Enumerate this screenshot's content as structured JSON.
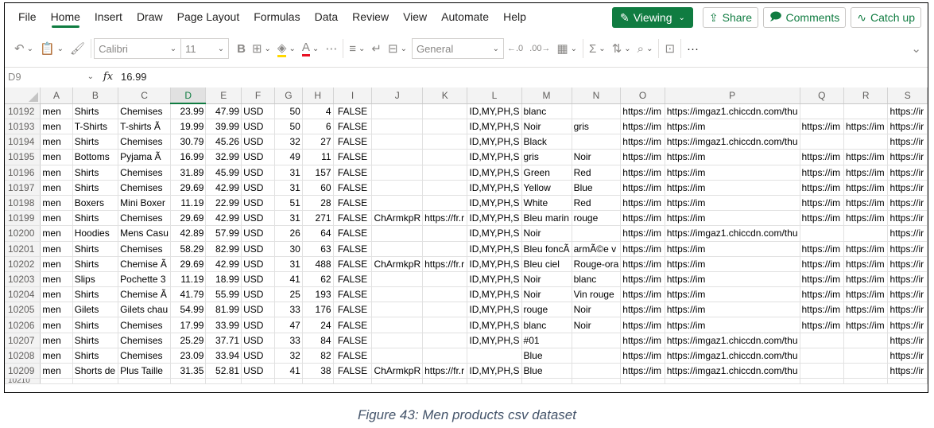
{
  "menu": {
    "items": [
      "File",
      "Home",
      "Insert",
      "Draw",
      "Page Layout",
      "Formulas",
      "Data",
      "Review",
      "View",
      "Automate",
      "Help"
    ],
    "active": "Home",
    "viewing_label": "Viewing",
    "share_label": "Share",
    "comments_label": "Comments",
    "catchup_label": "Catch up"
  },
  "toolbar": {
    "font_name": "Calibri",
    "font_size": "11",
    "number_format": "General",
    "more": "···"
  },
  "formula_bar": {
    "cell_ref": "D9",
    "fx": "fx",
    "value": "16.99"
  },
  "columns": [
    "A",
    "B",
    "C",
    "D",
    "E",
    "F",
    "G",
    "H",
    "I",
    "J",
    "K",
    "L",
    "M",
    "N",
    "O",
    "P",
    "Q",
    "R",
    "S"
  ],
  "selected_column": "D",
  "rows": [
    {
      "n": "10192",
      "A": "men",
      "B": "Shirts",
      "C": "Chemises",
      "D": "23.99",
      "E": "47.99",
      "F": "USD",
      "G": "50",
      "H": "4",
      "I": "FALSE",
      "J": "",
      "K": "",
      "L": "ID,MY,PH,S",
      "M": "blanc",
      "N": "",
      "O": "https://im",
      "P": "https://imgaz1.chiccdn.com/thu",
      "Q": "",
      "R": "",
      "S": "https://ir"
    },
    {
      "n": "10193",
      "A": "men",
      "B": "T-Shirts",
      "C": "T-shirts Ã",
      "D": "19.99",
      "E": "39.99",
      "F": "USD",
      "G": "50",
      "H": "6",
      "I": "FALSE",
      "J": "",
      "K": "",
      "L": "ID,MY,PH,S",
      "M": "Noir",
      "N": "gris",
      "O": "https://im",
      "P": "https://im",
      "Q": "https://im",
      "R": "https://im",
      "S": "https://ir"
    },
    {
      "n": "10194",
      "A": "men",
      "B": "Shirts",
      "C": "Chemises",
      "D": "30.79",
      "E": "45.26",
      "F": "USD",
      "G": "32",
      "H": "27",
      "I": "FALSE",
      "J": "",
      "K": "",
      "L": "ID,MY,PH,S",
      "M": "Black",
      "N": "",
      "O": "https://im",
      "P": "https://imgaz1.chiccdn.com/thu",
      "Q": "",
      "R": "",
      "S": "https://ir"
    },
    {
      "n": "10195",
      "A": "men",
      "B": "Bottoms",
      "C": "Pyjama Ã",
      "D": "16.99",
      "E": "32.99",
      "F": "USD",
      "G": "49",
      "H": "11",
      "I": "FALSE",
      "J": "",
      "K": "",
      "L": "ID,MY,PH,S",
      "M": "gris",
      "N": "Noir",
      "O": "https://im",
      "P": "https://im",
      "Q": "https://im",
      "R": "https://im",
      "S": "https://ir"
    },
    {
      "n": "10196",
      "A": "men",
      "B": "Shirts",
      "C": "Chemises",
      "D": "31.89",
      "E": "45.99",
      "F": "USD",
      "G": "31",
      "H": "157",
      "I": "FALSE",
      "J": "",
      "K": "",
      "L": "ID,MY,PH,S",
      "M": "Green",
      "N": "Red",
      "O": "https://im",
      "P": "https://im",
      "Q": "https://im",
      "R": "https://im",
      "S": "https://ir"
    },
    {
      "n": "10197",
      "A": "men",
      "B": "Shirts",
      "C": "Chemises",
      "D": "29.69",
      "E": "42.99",
      "F": "USD",
      "G": "31",
      "H": "60",
      "I": "FALSE",
      "J": "",
      "K": "",
      "L": "ID,MY,PH,S",
      "M": "Yellow",
      "N": "Blue",
      "O": "https://im",
      "P": "https://im",
      "Q": "https://im",
      "R": "https://im",
      "S": "https://ir"
    },
    {
      "n": "10198",
      "A": "men",
      "B": "Boxers",
      "C": "Mini Boxer",
      "D": "11.19",
      "E": "22.99",
      "F": "USD",
      "G": "51",
      "H": "28",
      "I": "FALSE",
      "J": "",
      "K": "",
      "L": "ID,MY,PH,S",
      "M": "White",
      "N": "Red",
      "O": "https://im",
      "P": "https://im",
      "Q": "https://im",
      "R": "https://im",
      "S": "https://ir"
    },
    {
      "n": "10199",
      "A": "men",
      "B": "Shirts",
      "C": "Chemises",
      "D": "29.69",
      "E": "42.99",
      "F": "USD",
      "G": "31",
      "H": "271",
      "I": "FALSE",
      "J": "ChArmkpR",
      "K": "https://fr.r",
      "L": "ID,MY,PH,S",
      "M": "Bleu marin",
      "N": "rouge",
      "O": "https://im",
      "P": "https://im",
      "Q": "https://im",
      "R": "https://im",
      "S": "https://ir"
    },
    {
      "n": "10200",
      "A": "men",
      "B": "Hoodies",
      "C": "Mens Casu",
      "D": "42.89",
      "E": "57.99",
      "F": "USD",
      "G": "26",
      "H": "64",
      "I": "FALSE",
      "J": "",
      "K": "",
      "L": "ID,MY,PH,S",
      "M": "Noir",
      "N": "",
      "O": "https://im",
      "P": "https://imgaz1.chiccdn.com/thu",
      "Q": "",
      "R": "",
      "S": "https://ir"
    },
    {
      "n": "10201",
      "A": "men",
      "B": "Shirts",
      "C": "Chemises",
      "D": "58.29",
      "E": "82.99",
      "F": "USD",
      "G": "30",
      "H": "63",
      "I": "FALSE",
      "J": "",
      "K": "",
      "L": "ID,MY,PH,S",
      "M": "Bleu foncÃ",
      "N": "armÃ©e v",
      "O": "https://im",
      "P": "https://im",
      "Q": "https://im",
      "R": "https://im",
      "S": "https://ir"
    },
    {
      "n": "10202",
      "A": "men",
      "B": "Shirts",
      "C": "Chemise Ã",
      "D": "29.69",
      "E": "42.99",
      "F": "USD",
      "G": "31",
      "H": "488",
      "I": "FALSE",
      "J": "ChArmkpR",
      "K": "https://fr.r",
      "L": "ID,MY,PH,S",
      "M": "Bleu ciel",
      "N": "Rouge-ora",
      "O": "https://im",
      "P": "https://im",
      "Q": "https://im",
      "R": "https://im",
      "S": "https://ir"
    },
    {
      "n": "10203",
      "A": "men",
      "B": "Slips",
      "C": "Pochette 3",
      "D": "11.19",
      "E": "18.99",
      "F": "USD",
      "G": "41",
      "H": "62",
      "I": "FALSE",
      "J": "",
      "K": "",
      "L": "ID,MY,PH,S",
      "M": "Noir",
      "N": "blanc",
      "O": "https://im",
      "P": "https://im",
      "Q": "https://im",
      "R": "https://im",
      "S": "https://ir"
    },
    {
      "n": "10204",
      "A": "men",
      "B": "Shirts",
      "C": "Chemise Ã",
      "D": "41.79",
      "E": "55.99",
      "F": "USD",
      "G": "25",
      "H": "193",
      "I": "FALSE",
      "J": "",
      "K": "",
      "L": "ID,MY,PH,S",
      "M": "Noir",
      "N": "Vin rouge",
      "O": "https://im",
      "P": "https://im",
      "Q": "https://im",
      "R": "https://im",
      "S": "https://ir"
    },
    {
      "n": "10205",
      "A": "men",
      "B": "Gilets",
      "C": "Gilets chau",
      "D": "54.99",
      "E": "81.99",
      "F": "USD",
      "G": "33",
      "H": "176",
      "I": "FALSE",
      "J": "",
      "K": "",
      "L": "ID,MY,PH,S",
      "M": "rouge",
      "N": "Noir",
      "O": "https://im",
      "P": "https://im",
      "Q": "https://im",
      "R": "https://im",
      "S": "https://ir"
    },
    {
      "n": "10206",
      "A": "men",
      "B": "Shirts",
      "C": "Chemises",
      "D": "17.99",
      "E": "33.99",
      "F": "USD",
      "G": "47",
      "H": "24",
      "I": "FALSE",
      "J": "",
      "K": "",
      "L": "ID,MY,PH,S",
      "M": "blanc",
      "N": "Noir",
      "O": "https://im",
      "P": "https://im",
      "Q": "https://im",
      "R": "https://im",
      "S": "https://ir"
    },
    {
      "n": "10207",
      "A": "men",
      "B": "Shirts",
      "C": "Chemises",
      "D": "25.29",
      "E": "37.71",
      "F": "USD",
      "G": "33",
      "H": "84",
      "I": "FALSE",
      "J": "",
      "K": "",
      "L": "ID,MY,PH,S",
      "M": "#01",
      "N": "",
      "O": "https://im",
      "P": "https://imgaz1.chiccdn.com/thu",
      "Q": "",
      "R": "",
      "S": "https://ir"
    },
    {
      "n": "10208",
      "A": "men",
      "B": "Shirts",
      "C": "Chemises",
      "D": "23.09",
      "E": "33.94",
      "F": "USD",
      "G": "32",
      "H": "82",
      "I": "FALSE",
      "J": "",
      "K": "",
      "L": "",
      "M": "Blue",
      "N": "",
      "O": "https://im",
      "P": "https://imgaz1.chiccdn.com/thu",
      "Q": "",
      "R": "",
      "S": "https://ir"
    },
    {
      "n": "10209",
      "A": "men",
      "B": "Shorts de",
      "C": "Plus Taille",
      "D": "31.35",
      "E": "52.81",
      "F": "USD",
      "G": "41",
      "H": "38",
      "I": "FALSE",
      "J": "ChArmkpR",
      "K": "https://fr.r",
      "L": "ID,MY,PH,S",
      "M": "Blue",
      "N": "",
      "O": "https://im",
      "P": "https://imgaz1.chiccdn.com/thu",
      "Q": "",
      "R": "",
      "S": "https://ir"
    }
  ],
  "partial_row_label": "10210",
  "caption": "Figure 43: Men products csv dataset",
  "colors": {
    "accent": "#107c41",
    "caption": "#44546a"
  }
}
